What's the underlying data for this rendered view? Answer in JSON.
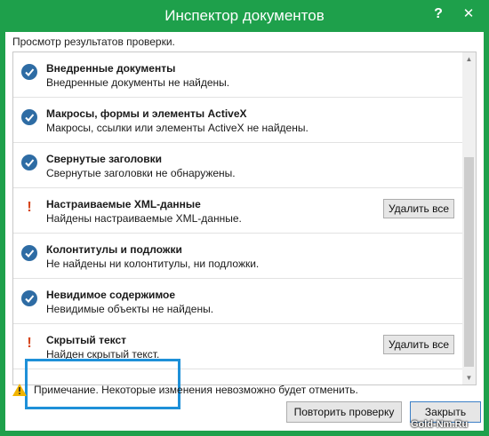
{
  "window": {
    "title": "Инспектор документов",
    "help_icon": "?",
    "close_icon": "✕",
    "frame_color": "#1ea04b"
  },
  "subtitle": "Просмотр результатов проверки.",
  "items": [
    {
      "status": "ok",
      "title": "Внедренные документы",
      "description": "Внедренные документы не найдены.",
      "button": ""
    },
    {
      "status": "ok",
      "title": "Макросы, формы и элементы ActiveX",
      "description": "Макросы, ссылки или элементы ActiveX не найдены.",
      "button": ""
    },
    {
      "status": "ok",
      "title": "Свернутые заголовки",
      "description": "Свернутые заголовки не обнаружены.",
      "button": ""
    },
    {
      "status": "warning",
      "title": "Настраиваемые XML-данные",
      "description": "Найдены настраиваемые XML-данные.",
      "button": "Удалить все"
    },
    {
      "status": "ok",
      "title": "Колонтитулы и подложки",
      "description": "Не найдены ни колонтитулы, ни подложки.",
      "button": ""
    },
    {
      "status": "ok",
      "title": "Невидимое содержимое",
      "description": "Невидимые объекты не найдены.",
      "button": ""
    },
    {
      "status": "warning",
      "title": "Скрытый текст",
      "description": "Найден скрытый текст.",
      "button": "Удалить все"
    }
  ],
  "note": "Примечание. Некоторые изменения невозможно будет отменить.",
  "buttons": {
    "recheck": "Повторить проверку",
    "close": "Закрыть"
  },
  "watermark": "Gold-Nm.Ru",
  "colors": {
    "check": "#2e6ca4",
    "warning": "#d6451b",
    "highlight": "#1e90d8"
  }
}
